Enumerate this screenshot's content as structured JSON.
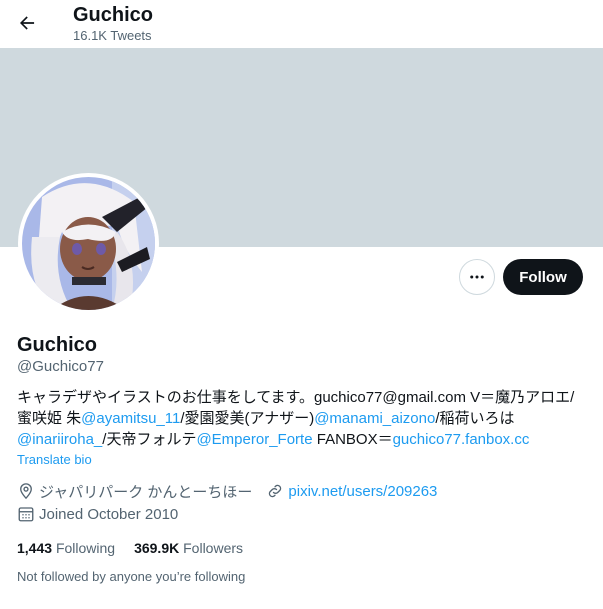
{
  "header": {
    "name": "Guchico",
    "tweet_count": "16.1K Tweets"
  },
  "colors": {
    "banner": "#cfd9de",
    "link": "#1d9bf0",
    "follow_button": "#0f1419",
    "secondary_text": "#536471"
  },
  "icons": {
    "back": "arrow-left-icon",
    "more": "more-dots-icon",
    "location": "location-pin-icon",
    "website": "link-icon",
    "joined": "calendar-icon"
  },
  "profile": {
    "display_name": "Guchico",
    "handle": "@Guchico77",
    "follow_label": "Follow",
    "bio": {
      "line1": "キャラデザやイラストのお仕事をしてます。guchico77@gmail.com V＝魔乃アロエ/",
      "line2_prefix": "蜜咲姫 朱",
      "mention1": "@ayamitsu_11",
      "line2_mid": "/愛園愛美(アナザー)",
      "mention2": "@manami_aizono",
      "line2_suffix": "/稲荷いろは",
      "mention3": "@inariiroha_",
      "line3_mid": "/天帝フォルテ",
      "mention4": "@Emperor_Forte",
      "line3_text": " FANBOX＝",
      "fanbox_link": "guchico77.fanbox.cc"
    },
    "translate_label": "Translate bio",
    "location": "ジャパリパーク かんとーちほー",
    "website": "pixiv.net/users/209263",
    "joined": "Joined October 2010",
    "following_count": "1,443",
    "following_label": "Following",
    "followers_count": "369.9K",
    "followers_label": "Followers",
    "not_followed_note": "Not followed by anyone you’re following"
  }
}
